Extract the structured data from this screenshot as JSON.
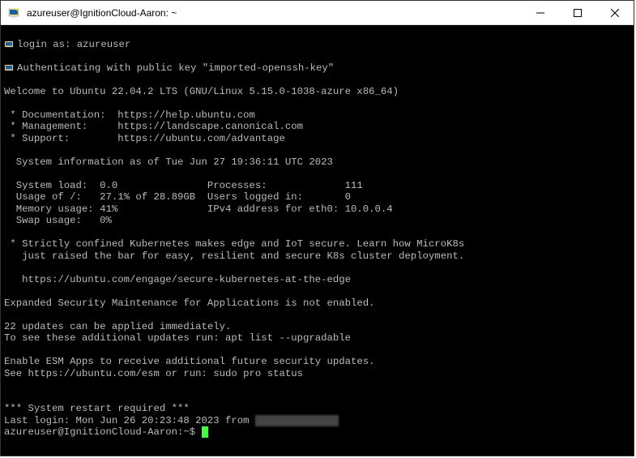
{
  "window": {
    "title": "azureuser@IgnitionCloud-Aaron: ~"
  },
  "login": {
    "prompt": "login as: ",
    "user": "azureuser",
    "authLine": "Authenticating with public key \"imported-openssh-key\""
  },
  "welcome": "Welcome to Ubuntu 22.04.2 LTS (GNU/Linux 5.15.0-1038-azure x86_64)",
  "links": {
    "docLabel": " * Documentation:  https://help.ubuntu.com",
    "mgmtLabel": " * Management:     https://landscape.canonical.com",
    "supLabel": " * Support:        https://ubuntu.com/advantage"
  },
  "sysinfoHeader": "  System information as of Tue Jun 27 19:36:11 UTC 2023",
  "sysinfo": {
    "row1": "  System load:  0.0               Processes:             111",
    "row2": "  Usage of /:   27.1% of 28.89GB  Users logged in:       0",
    "row3": "  Memory usage: 41%               IPv4 address for eth0: 10.0.0.4",
    "row4": "  Swap usage:   0%"
  },
  "promo": {
    "l1": " * Strictly confined Kubernetes makes edge and IoT secure. Learn how MicroK8s",
    "l2": "   just raised the bar for easy, resilient and secure K8s cluster deployment.",
    "l3": "   https://ubuntu.com/engage/secure-kubernetes-at-the-edge"
  },
  "esm": {
    "l1": "Expanded Security Maintenance for Applications is not enabled.",
    "l2": "22 updates can be applied immediately.",
    "l3": "To see these additional updates run: apt list --upgradable",
    "l4": "Enable ESM Apps to receive additional future security updates.",
    "l5": "See https://ubuntu.com/esm or run: sudo pro status"
  },
  "restart": "*** System restart required ***",
  "lastLoginPrefix": "Last login: Mon Jun 26 20:23:48 2023 from ",
  "lastLoginRedacted": "xx.xxx.xxx.xxx",
  "prompt": "azureuser@IgnitionCloud-Aaron:~$ "
}
